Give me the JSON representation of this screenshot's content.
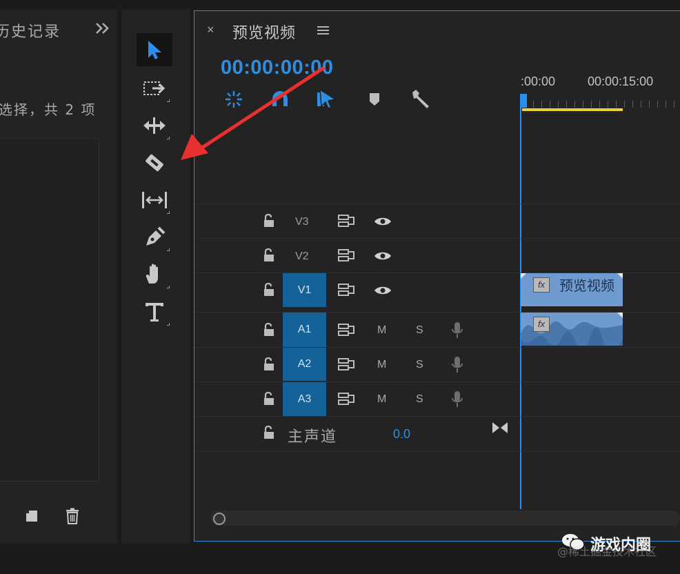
{
  "history_panel": {
    "title": "历史记录",
    "expand_icon": "double-chevron-right-icon",
    "status": "选择，共 2 项",
    "new_icon": "new-item-icon",
    "delete_icon": "trash-icon"
  },
  "tools": [
    {
      "name": "selection-tool",
      "icon": "arrow-icon",
      "selected": true
    },
    {
      "name": "track-select-tool",
      "icon": "track-select-icon"
    },
    {
      "name": "ripple-edit-tool",
      "icon": "ripple-edit-icon"
    },
    {
      "name": "razor-tool",
      "icon": "razor-icon"
    },
    {
      "name": "slip-tool",
      "icon": "slip-icon"
    },
    {
      "name": "pen-tool",
      "icon": "pen-icon"
    },
    {
      "name": "hand-tool",
      "icon": "hand-icon"
    },
    {
      "name": "type-tool",
      "icon": "type-icon"
    }
  ],
  "timeline": {
    "close_label": "×",
    "title": "预览视频",
    "menu_icon": "hamburger-menu-icon",
    "timecode": "00:00:00:00",
    "ruler": [
      ":00:00",
      "00:00:15:00"
    ],
    "toolbar_icons": [
      "snap-icon",
      "linked-selection-icon",
      "add-marker-icon",
      "marker-icon",
      "wrench-icon"
    ],
    "video_tracks": [
      {
        "label": "V3",
        "target": false
      },
      {
        "label": "V2",
        "target": false
      },
      {
        "label": "V1",
        "target": true
      }
    ],
    "audio_tracks": [
      {
        "label": "A1",
        "mute": "M",
        "solo": "S"
      },
      {
        "label": "A2",
        "mute": "M",
        "solo": "S"
      },
      {
        "label": "A3",
        "mute": "M",
        "solo": "S"
      }
    ],
    "master": {
      "label": "主声道",
      "value": "0.0"
    },
    "clip_video": {
      "fx": "fx",
      "name": "预览视频"
    },
    "clip_audio": {
      "fx": "fx"
    }
  },
  "annotation": {
    "color": "#e8312f"
  },
  "watermark": {
    "brand": "游戏内圈",
    "sub": "@稀土掘金技术社区"
  },
  "colors": {
    "accent": "#2e86de",
    "timecode": "#2f8ee0",
    "track_target": "#156299",
    "clip": "#6f9bd1",
    "work_area": "#e6d23a"
  }
}
